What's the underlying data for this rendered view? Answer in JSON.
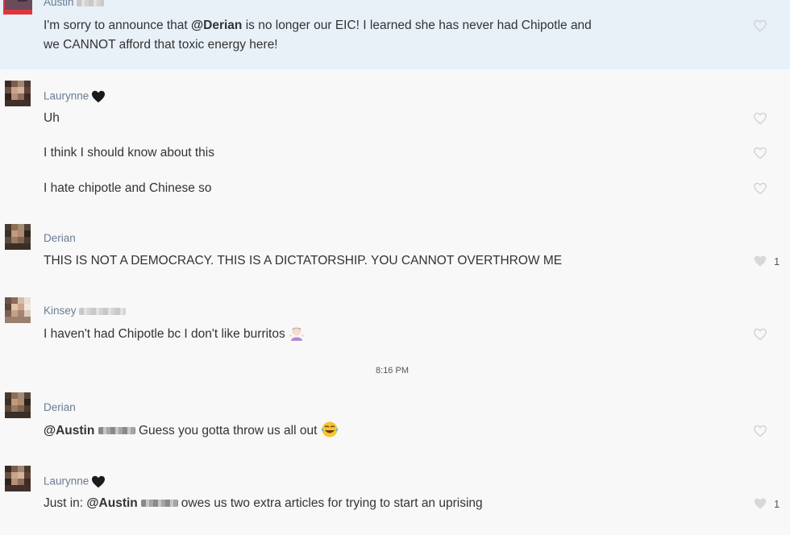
{
  "colors": {
    "highlight": "#e8f0f8",
    "name": "#687c94",
    "text": "#333333",
    "heart_outline": "#cfcfcf",
    "heart_filled": "#d8d8d8"
  },
  "messages": [
    {
      "author": "Austin",
      "text_pre": "I'm sorry to announce that ",
      "mention": "@Derian",
      "text_post": " is no longer our EIC! I learned she has never had Chipotle and",
      "text_line2": "we CANNOT afford that toxic energy here!"
    },
    {
      "author": "Laurynne",
      "lines": [
        "Uh",
        "I think I should know about this",
        "I hate chipotle and Chinese so"
      ]
    },
    {
      "author": "Derian",
      "text": "THIS IS NOT A DEMOCRACY. THIS IS A DICTATORSHIP. YOU CANNOT OVERTHROW ME",
      "likes": "1"
    },
    {
      "author": "Kinsey",
      "text": "I haven't had Chipotle bc I don't like burritos",
      "emoji": "woman-shrugging"
    },
    {
      "author": "Derian",
      "mention": "@Austin",
      "text": "Guess you gotta throw us all out",
      "emoji": "tears-of-joy"
    },
    {
      "author": "Laurynne",
      "text_pre": "Just in: ",
      "mention": "@Austin",
      "text_post": "owes us two extra articles for trying to start an uprising",
      "likes": "1"
    }
  ],
  "timestamp": "8:16 PM"
}
